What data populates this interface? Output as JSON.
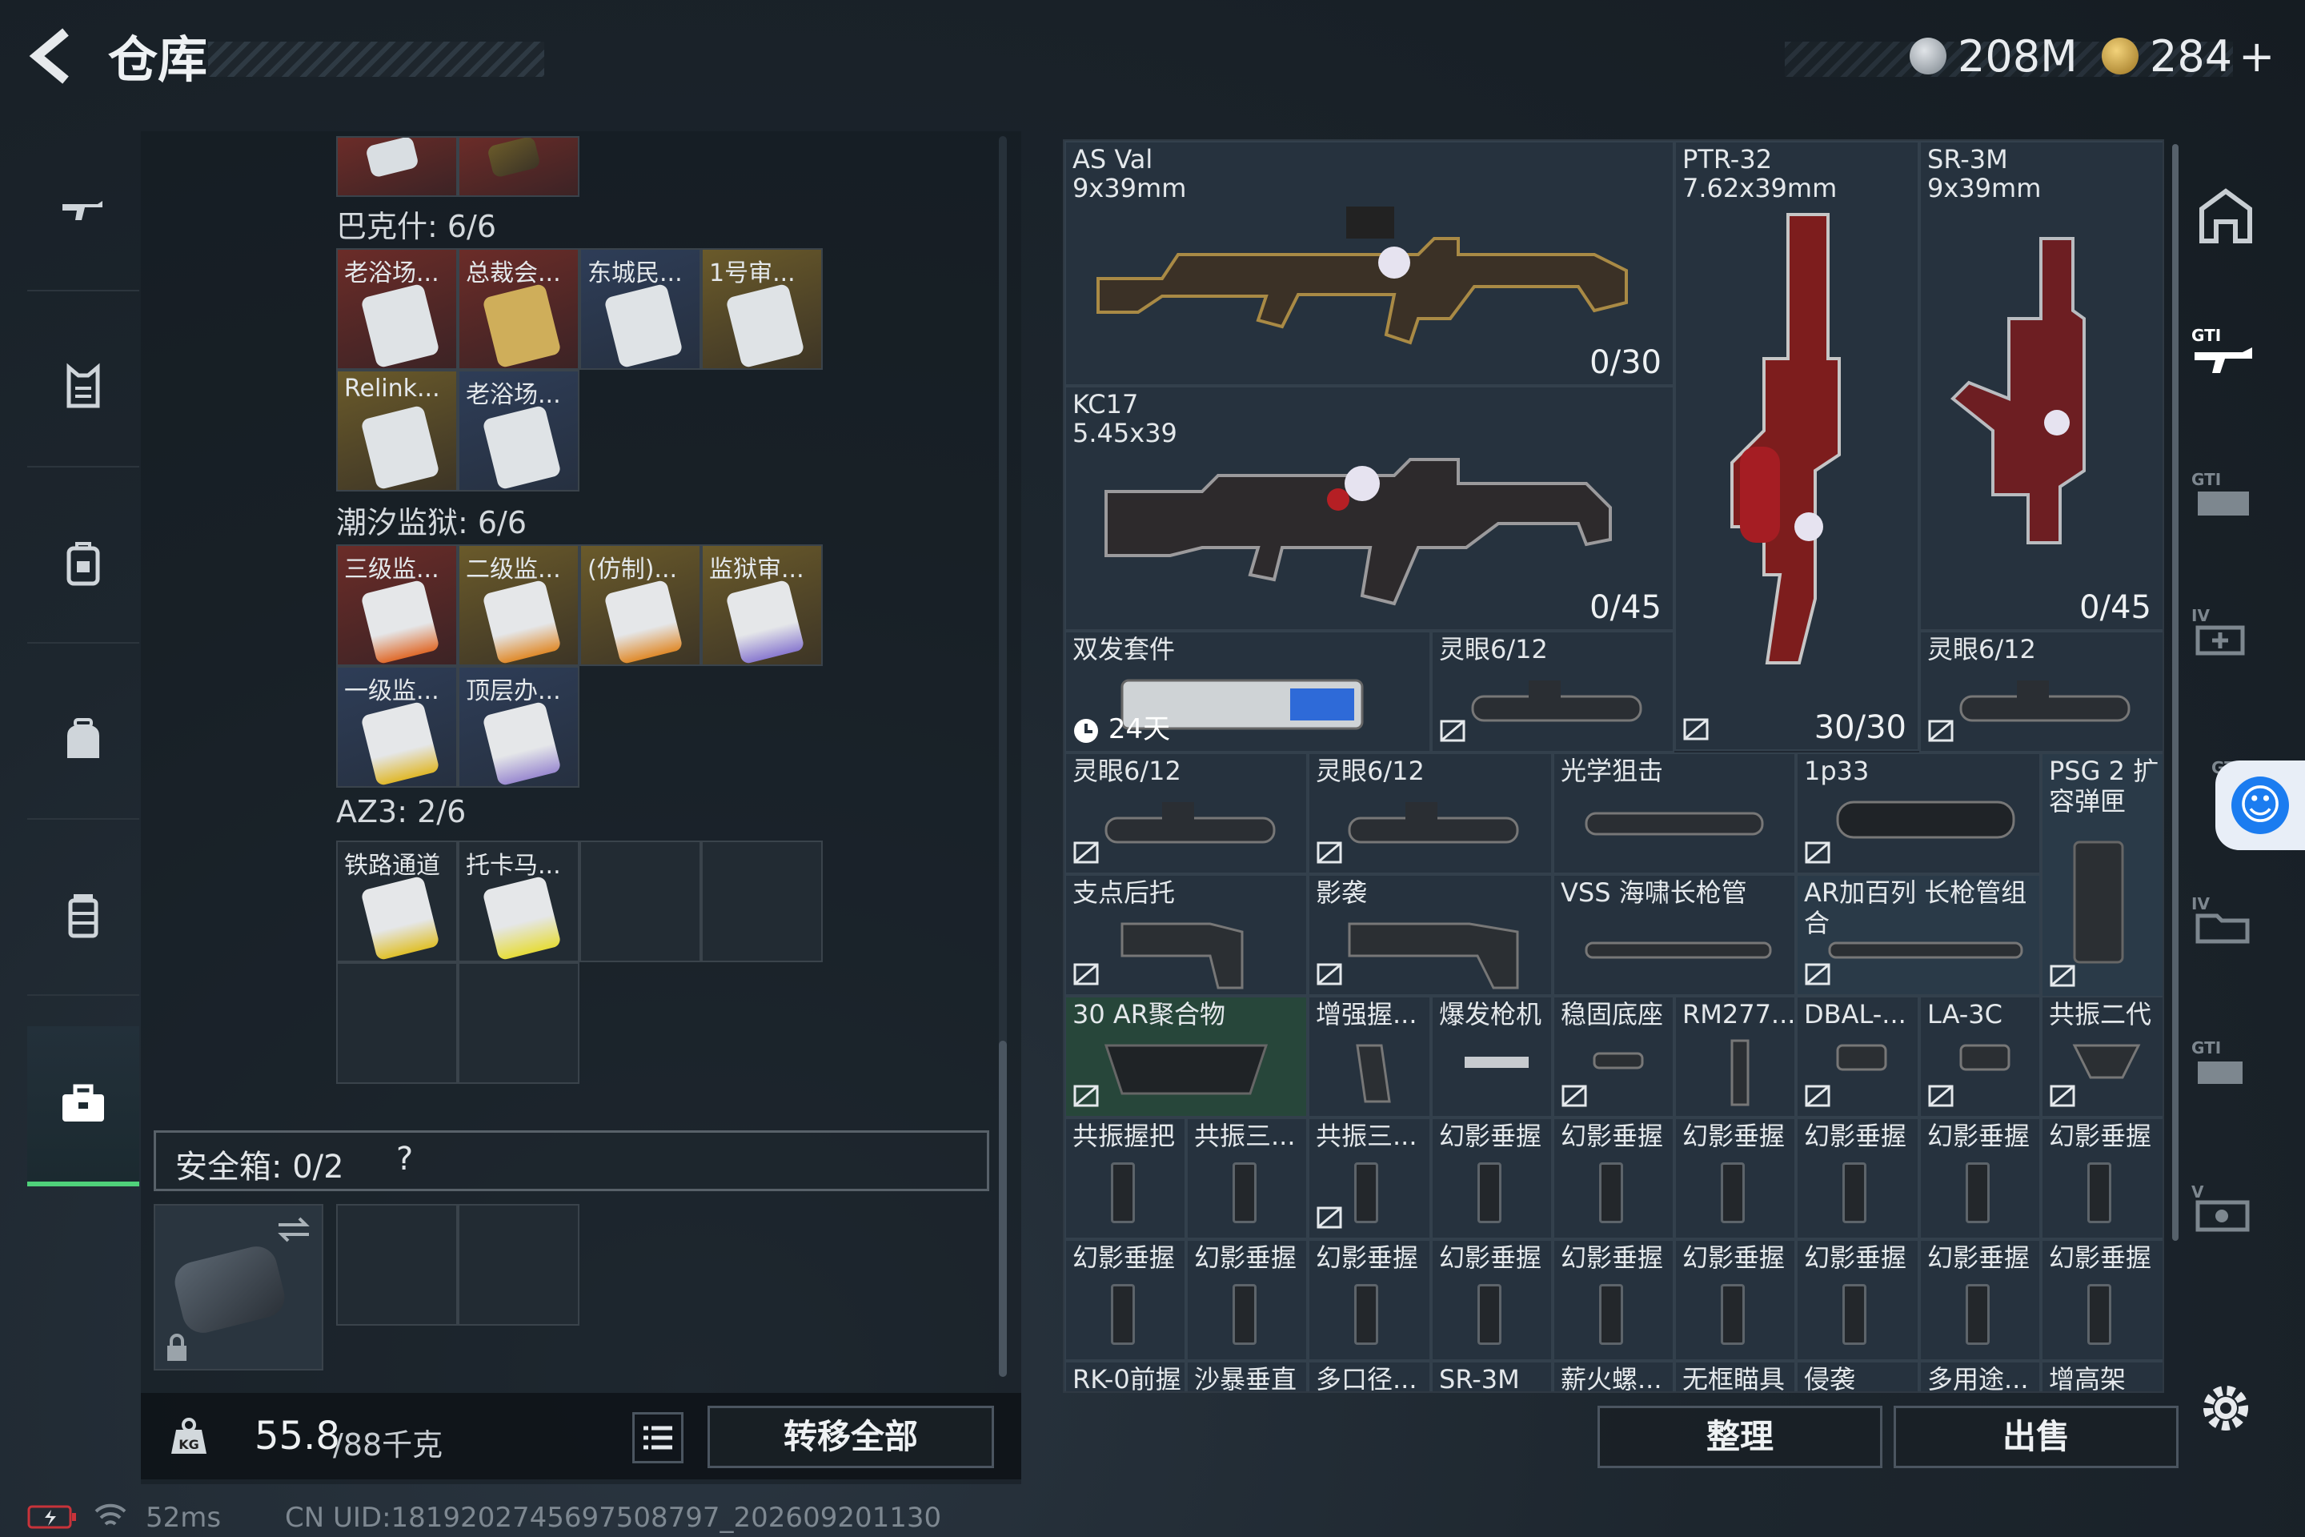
{
  "topbar": {
    "back_label": "<",
    "title": "仓库",
    "currency1": "208M",
    "currency2": "284",
    "currency2_plus": "+"
  },
  "left_nav": [
    {
      "name": "weapons",
      "icon": "rifle-icon"
    },
    {
      "name": "armor",
      "icon": "vest-icon"
    },
    {
      "name": "backpack",
      "icon": "backpack-icon"
    },
    {
      "name": "bag",
      "icon": "bag-icon"
    },
    {
      "name": "consumables",
      "icon": "jar-icon"
    },
    {
      "name": "keys",
      "icon": "briefcase-icon"
    }
  ],
  "sections": [
    {
      "label": "巴克什: 6/6",
      "cells": [
        "老浴场...",
        "总裁会...",
        "东城民...",
        "1号审...",
        "Relink...",
        "老浴场..."
      ]
    },
    {
      "label": "潮汐监狱: 6/6",
      "cells": [
        "三级监...",
        "二级监...",
        "(仿制)...",
        "监狱审...",
        "一级监...",
        "顶层办..."
      ]
    },
    {
      "label": "AZ3: 2/6",
      "cells": [
        "铁路通道",
        "托卡马..."
      ]
    }
  ],
  "safe": {
    "label": "安全箱: 0/2",
    "help": "?"
  },
  "footer": {
    "weight_value": "55.8",
    "weight_max": "/88千克",
    "transfer_all": "转移全部",
    "sort": "整理",
    "sell": "出售"
  },
  "grid": {
    "weapons": [
      {
        "name": "AS Val",
        "ammo_type": "9x39mm",
        "ammo": "0/30"
      },
      {
        "name": "PTR-32",
        "ammo_type": "7.62x39mm",
        "ammo": "30/30"
      },
      {
        "name": "SR-3M",
        "ammo_type": "9x39mm",
        "ammo": "0/45"
      },
      {
        "name": "KC17",
        "ammo_type": "5.45x39",
        "ammo": "0/45"
      }
    ],
    "row3": [
      {
        "name": "双发套件",
        "timer": "24天"
      },
      {
        "name": "灵眼6/12"
      },
      {
        "name": "灵眼6/12"
      }
    ],
    "row4": [
      "灵眼6/12",
      "灵眼6/12",
      "光学狙击",
      "1p33",
      "PSG 2 扩容弹匣"
    ],
    "row5": [
      "支点后托",
      "影袭",
      "VSS 海啸长枪管",
      "AR加百列 长枪管组合"
    ],
    "row6": [
      "30 AR聚合物",
      "增强握...",
      "爆发枪机",
      "稳固底座",
      "RM277...",
      "DBAL-...",
      "LA-3C",
      "共振二代"
    ],
    "row7": [
      "共振握把",
      "共振三...",
      "共振三...",
      "幻影垂握",
      "幻影垂握",
      "幻影垂握",
      "幻影垂握",
      "幻影垂握",
      "幻影垂握"
    ],
    "row8": [
      "幻影垂握",
      "幻影垂握",
      "幻影垂握",
      "幻影垂握",
      "幻影垂握",
      "幻影垂握",
      "幻影垂握",
      "幻影垂握",
      "幻影垂握"
    ],
    "row9": [
      "RK-0前握",
      "沙暴垂直",
      "多口径...",
      "SR-3M",
      "薪火螺...",
      "无框瞄具",
      "侵袭",
      "多用途...",
      "增高架"
    ]
  },
  "status": {
    "ping": "52ms",
    "uid": "CN UID:18192027456975087​97_202609201130"
  }
}
